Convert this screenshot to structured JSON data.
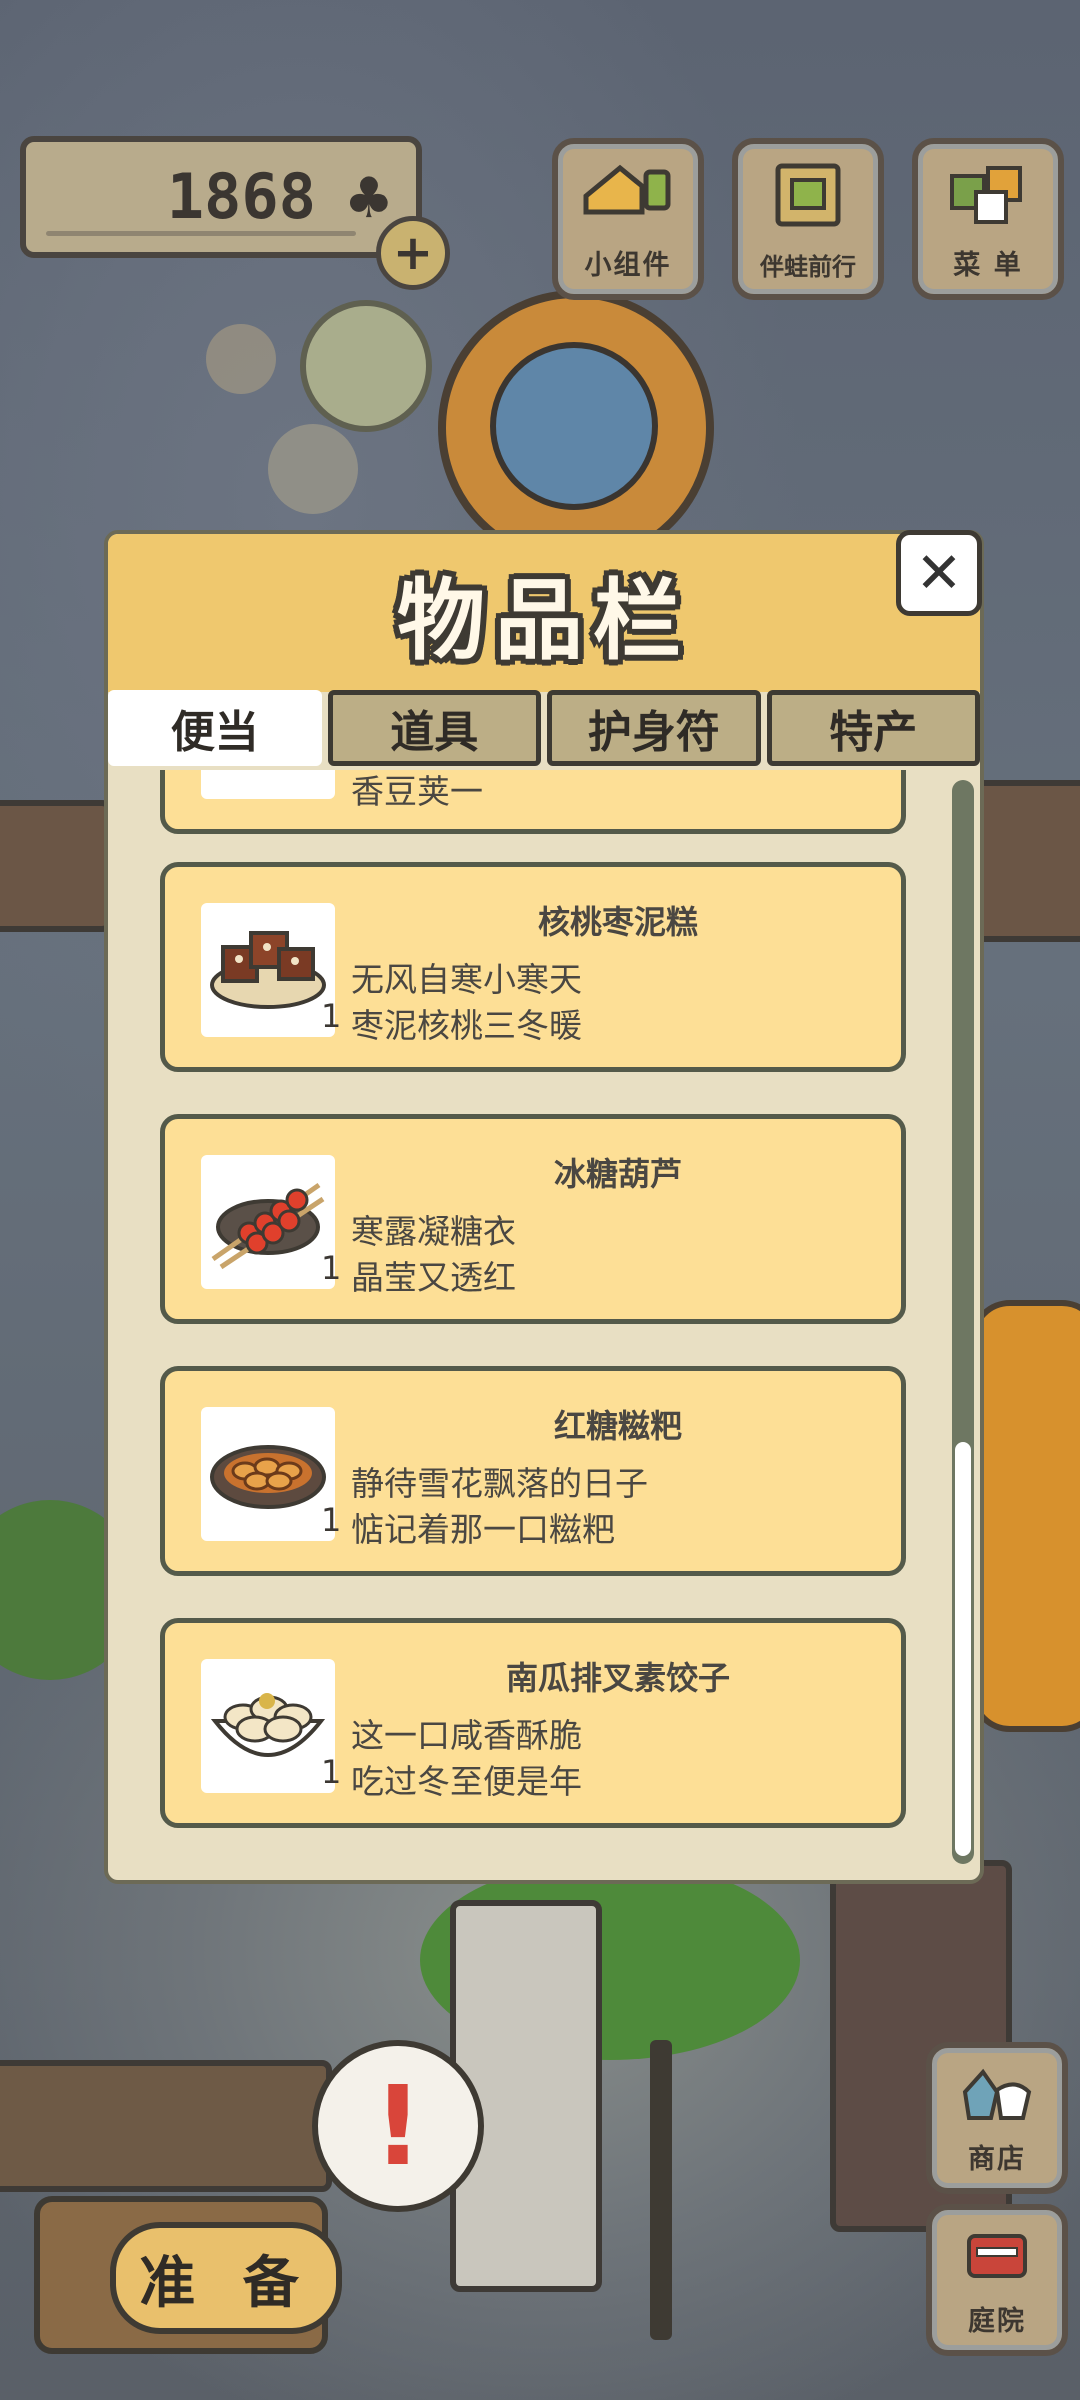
{
  "hud": {
    "clover_count": "1868",
    "clover_symbol": "♣",
    "add_symbol": "+",
    "buttons": [
      {
        "label": "小组件",
        "icon": "widget-icon"
      },
      {
        "label": "伴蛙前行",
        "icon": "journal-icon"
      },
      {
        "label": "菜 单",
        "icon": "menu-cards-icon"
      }
    ]
  },
  "inventory": {
    "title": "物品栏",
    "close_symbol": "✕",
    "tabs": [
      {
        "label": "便当",
        "active": true
      },
      {
        "label": "道具",
        "active": false
      },
      {
        "label": "护身符",
        "active": false
      },
      {
        "label": "特产",
        "active": false
      }
    ],
    "items": [
      {
        "name": "核桃枣泥糕",
        "line1": "无风自寒小寒天",
        "line2": "枣泥核桃三冬暖",
        "qty": "1",
        "icon": "walnut-date-cake-icon"
      },
      {
        "name": "冰糖葫芦",
        "line1": "寒露凝糖衣",
        "line2": "晶莹又透红",
        "qty": "1",
        "icon": "candied-hawthorn-icon"
      },
      {
        "name": "红糖糍粑",
        "line1": "静待雪花飘落的日子",
        "line2": "惦记着那一口糍粑",
        "qty": "1",
        "icon": "brown-sugar-ciba-icon"
      },
      {
        "name": "南瓜排叉素饺子",
        "line1": "这一口咸香酥脆",
        "line2": "吃过冬至便是年",
        "qty": "1",
        "icon": "pumpkin-dumplings-icon"
      }
    ],
    "partial_item_text": "香豆荚一"
  },
  "bottom": {
    "prepare_label": "准 备",
    "alert_symbol": "!",
    "shop_label": "商店",
    "yard_label": "庭院"
  },
  "colors": {
    "card_bg": "#fddf96",
    "header_bg": "#efc86e",
    "panel_bg": "#e8dfc3",
    "alert_red": "#d9453a"
  }
}
